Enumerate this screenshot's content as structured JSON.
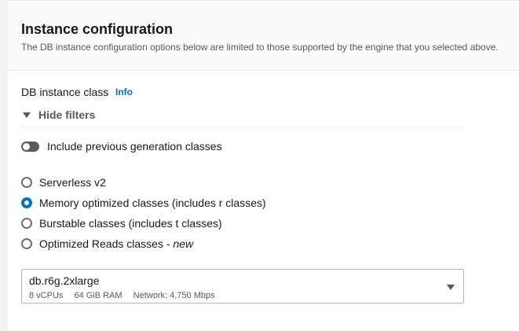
{
  "section": {
    "title": "Instance configuration",
    "description": "The DB instance configuration options below are limited to those supported by the engine that you selected above."
  },
  "instance_class": {
    "label": "DB instance class",
    "info_link": "Info",
    "filter_toggle": "Hide filters",
    "previous_generation": {
      "label": "Include previous generation classes",
      "enabled": false
    },
    "class_options": [
      {
        "label": "Serverless v2",
        "suffix": "",
        "selected": false
      },
      {
        "label": "Memory optimized classes (includes r classes)",
        "suffix": "",
        "selected": true
      },
      {
        "label": "Burstable classes (includes t classes)",
        "suffix": "",
        "selected": false
      },
      {
        "label": "Optimized Reads classes - ",
        "suffix": "new",
        "selected": false
      }
    ],
    "selected_instance": {
      "value": "db.r6g.2xlarge",
      "vcpus": "8 vCPUs",
      "ram": "64 GiB RAM",
      "network": "Network: 4,750 Mbps"
    }
  },
  "colors": {
    "accent": "#0073bb",
    "text": "#16191f",
    "secondary_text": "#545b64",
    "header_bg": "#fafafa"
  },
  "icons": {
    "filter_caret": "caret-down-icon",
    "select_caret": "caret-down-icon"
  }
}
